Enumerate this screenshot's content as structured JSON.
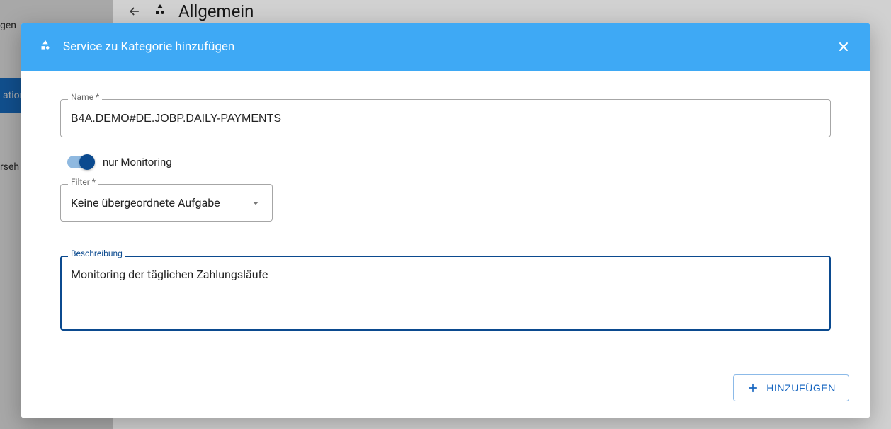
{
  "background": {
    "sidebar_text1": "gen",
    "sidebar_highlight": "ation",
    "sidebar_text2": "rseh",
    "title": "Allgemein"
  },
  "dialog": {
    "title": "Service zu Kategorie hinzufügen",
    "name_label": "Name *",
    "name_value": "B4A.DEMO#DE.JOBP.DAILY-PAYMENTS",
    "monitoring_toggle_label": "nur Monitoring",
    "monitoring_toggle_on": true,
    "filter_label": "Filter *",
    "filter_selected": "Keine übergeordnete Aufgabe",
    "description_label": "Beschreibung",
    "description_value": "Monitoring der täglichen Zahlungsläufe",
    "add_button_label": "HINZUFÜGEN"
  }
}
